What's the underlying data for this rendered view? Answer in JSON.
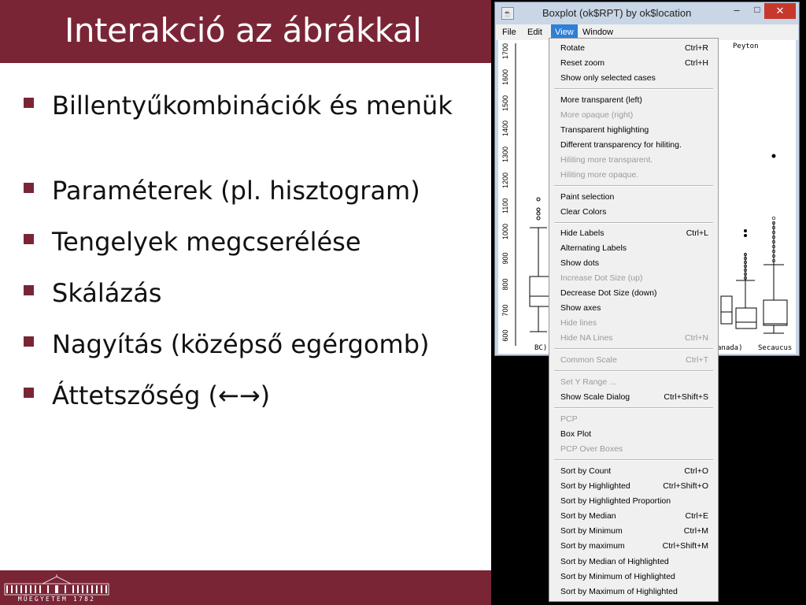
{
  "slide": {
    "title": "Interakció az ábrákkal",
    "footer_text": "MŰEGYETEM 1782",
    "accent_color": "#7a2536",
    "bullets": [
      {
        "text": "Billentyűkombinációk és menük"
      },
      {
        "text": "Paraméterek (pl. hisztogram)"
      },
      {
        "text": "Tengelyek megcserélése"
      },
      {
        "text": "Skálázás"
      },
      {
        "text": "Nagyítás (középső egérgomb)"
      },
      {
        "text": "Áttetszőség (←→)"
      }
    ]
  },
  "window": {
    "title": "Boxplot (ok$RPT) by ok$location",
    "minimize": "–",
    "maximize": "□",
    "close": "✕",
    "menu": {
      "file": "File",
      "edit": "Edit",
      "view": "View",
      "window": "Window"
    }
  },
  "plot": {
    "y_ticks": [
      "1700",
      "1600",
      "1500",
      "1400",
      "1300",
      "1200",
      "1100",
      "1000",
      "900",
      "800",
      "700",
      "600"
    ],
    "category_labels": {
      "left": "BC)",
      "canada": "anada)",
      "secaucus": "Secaucus",
      "top_right": "Peyton"
    }
  },
  "view_menu": {
    "items": [
      {
        "label": "Rotate",
        "shortcut": "Ctrl+R",
        "enabled": true
      },
      {
        "label": "Reset zoom",
        "shortcut": "Ctrl+H",
        "enabled": true
      },
      {
        "label": "Show only selected cases",
        "shortcut": "",
        "enabled": true
      },
      {
        "label": "More transparent (left)",
        "shortcut": "",
        "enabled": true
      },
      {
        "label": "More opaque (right)",
        "shortcut": "",
        "enabled": false
      },
      {
        "label": "Transparent highlighting",
        "shortcut": "",
        "enabled": true
      },
      {
        "label": "Different transparency for hiliting.",
        "shortcut": "",
        "enabled": true
      },
      {
        "label": "Hiliting more transparent.",
        "shortcut": "",
        "enabled": false
      },
      {
        "label": "Hiliting more opaque.",
        "shortcut": "",
        "enabled": false
      },
      {
        "label": "Paint selection",
        "shortcut": "",
        "enabled": true
      },
      {
        "label": "Clear Colors",
        "shortcut": "",
        "enabled": true
      },
      {
        "label": "Hide Labels",
        "shortcut": "Ctrl+L",
        "enabled": true
      },
      {
        "label": "Alternating Labels",
        "shortcut": "",
        "enabled": true
      },
      {
        "label": "Show dots",
        "shortcut": "",
        "enabled": true
      },
      {
        "label": "Increase Dot Size (up)",
        "shortcut": "",
        "enabled": false
      },
      {
        "label": "Decrease Dot Size (down)",
        "shortcut": "",
        "enabled": true
      },
      {
        "label": "Show axes",
        "shortcut": "",
        "enabled": true
      },
      {
        "label": "Hide lines",
        "shortcut": "",
        "enabled": false
      },
      {
        "label": "Hide NA Lines",
        "shortcut": "Ctrl+N",
        "enabled": false
      },
      {
        "label": "Common Scale",
        "shortcut": "Ctrl+T",
        "enabled": false
      },
      {
        "label": "Set Y Range ...",
        "shortcut": "",
        "enabled": false
      },
      {
        "label": "Show Scale Dialog",
        "shortcut": "Ctrl+Shift+S",
        "enabled": true
      },
      {
        "label": "PCP",
        "shortcut": "",
        "enabled": false
      },
      {
        "label": "Box Plot",
        "shortcut": "",
        "enabled": true
      },
      {
        "label": "PCP Over Boxes",
        "shortcut": "",
        "enabled": false
      },
      {
        "label": "Sort by Count",
        "shortcut": "Ctrl+O",
        "enabled": true
      },
      {
        "label": "Sort by Highlighted",
        "shortcut": "Ctrl+Shift+O",
        "enabled": true
      },
      {
        "label": "Sort by Highlighted Proportion",
        "shortcut": "",
        "enabled": true
      },
      {
        "label": "Sort by Median",
        "shortcut": "Ctrl+E",
        "enabled": true
      },
      {
        "label": "Sort by Minimum",
        "shortcut": "Ctrl+M",
        "enabled": true
      },
      {
        "label": "Sort by maximum",
        "shortcut": "Ctrl+Shift+M",
        "enabled": true
      },
      {
        "label": "Sort by Median of Highlighted",
        "shortcut": "",
        "enabled": true
      },
      {
        "label": "Sort by Minimum of Highlighted",
        "shortcut": "",
        "enabled": true
      },
      {
        "label": "Sort by Maximum of Highlighted",
        "shortcut": "",
        "enabled": true
      }
    ]
  }
}
